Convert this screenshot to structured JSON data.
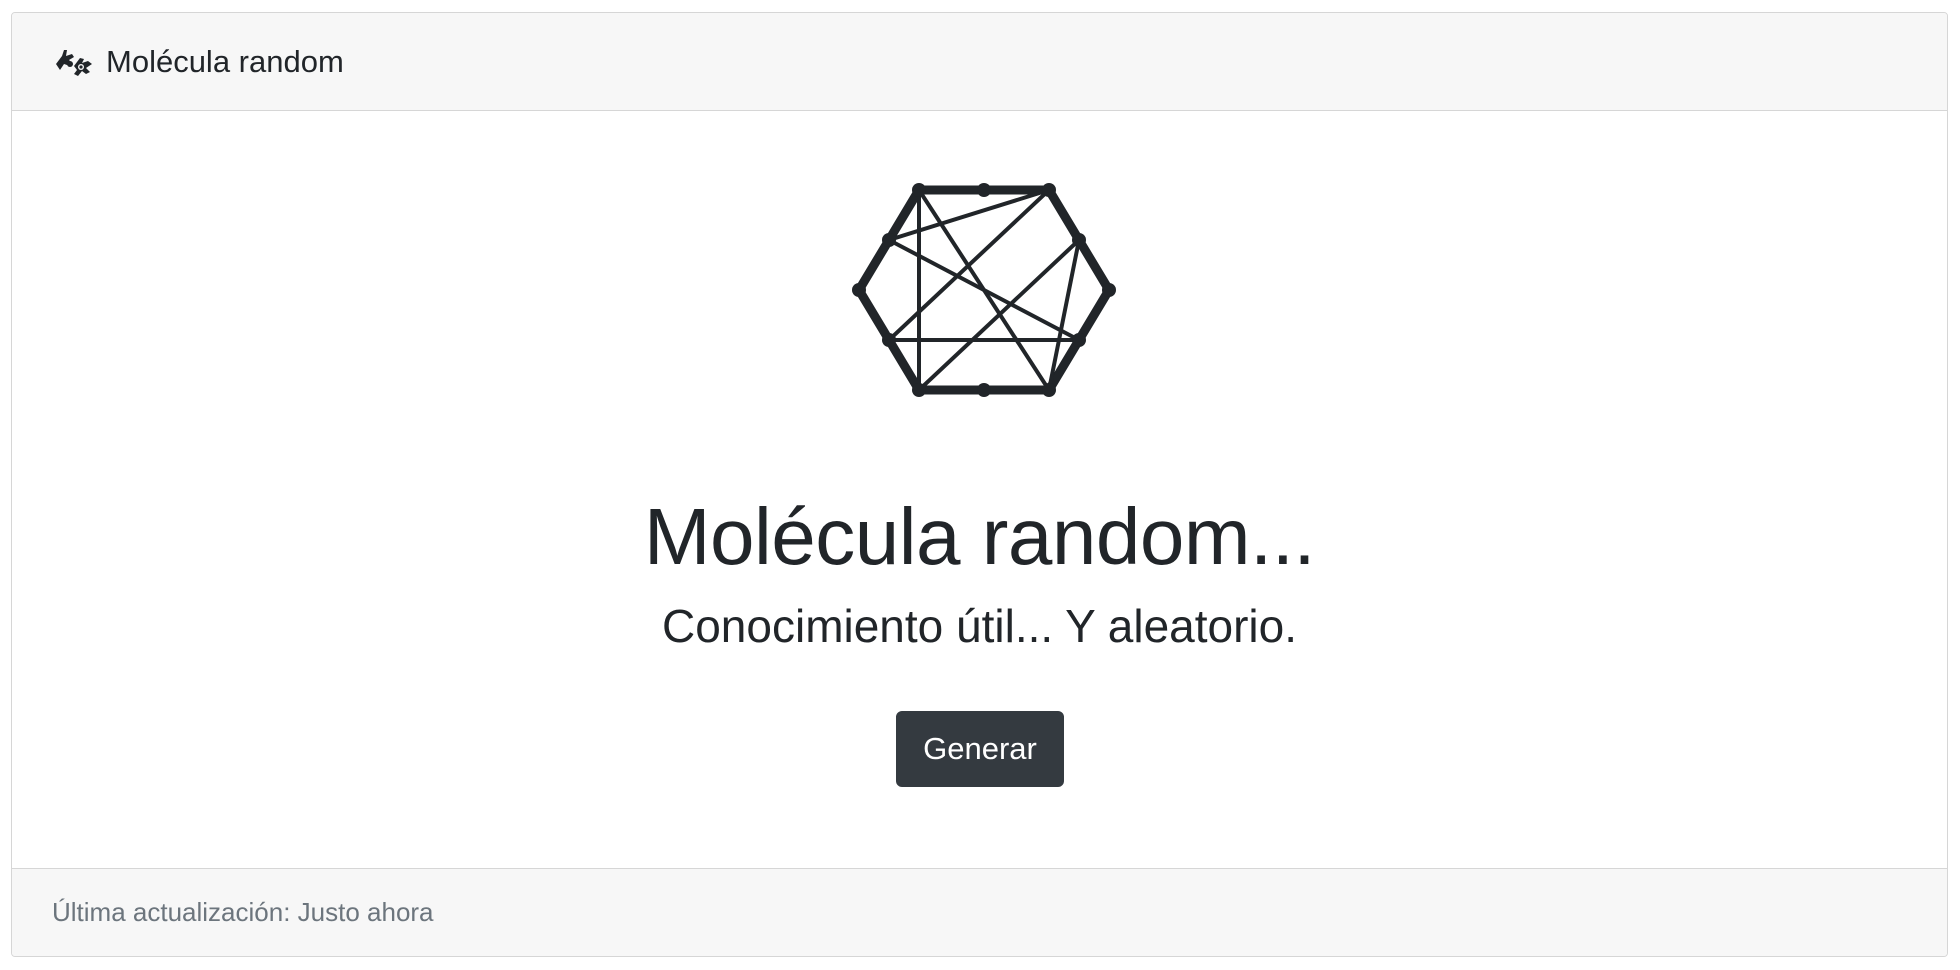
{
  "header": {
    "icon": "sign-language-hands-icon",
    "title": "Molécula random"
  },
  "main": {
    "graphic": "hexagon-molecule-graph-icon",
    "title": "Molécula random...",
    "subtitle": "Conocimiento útil... Y aleatorio.",
    "generate_label": "Generar"
  },
  "footer": {
    "updated_text": "Última actualización: Justo ahora"
  },
  "colors": {
    "dark": "#343a40",
    "text": "#212529",
    "muted": "#6c757d",
    "header_bg": "#f7f7f7"
  }
}
